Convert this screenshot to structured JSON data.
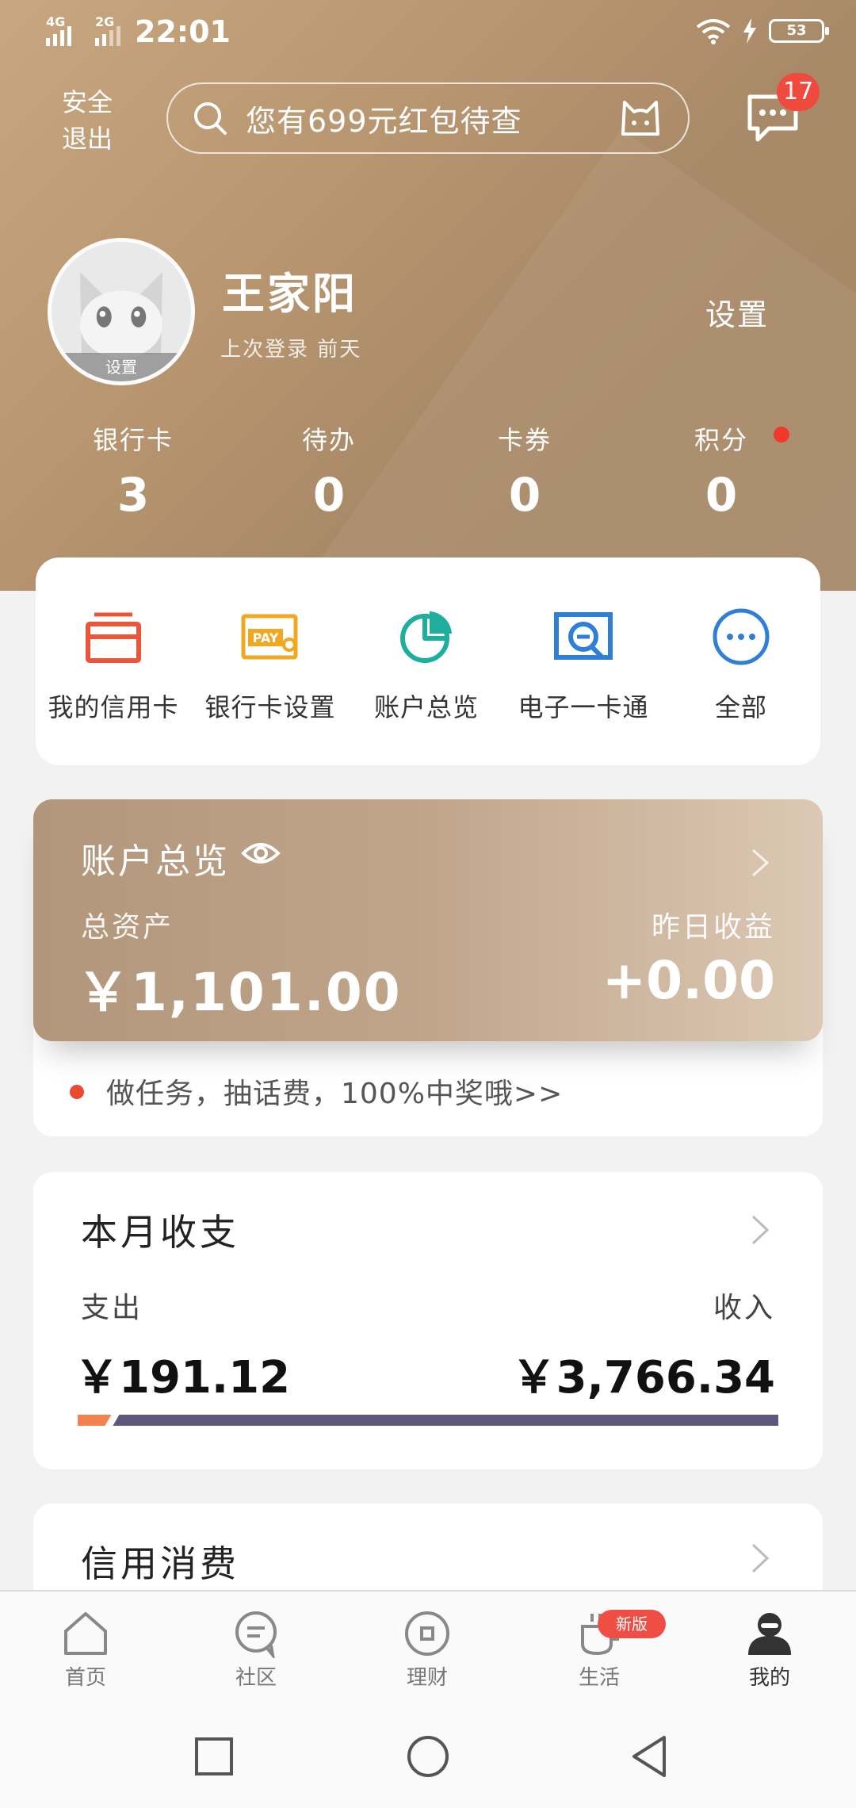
{
  "status": {
    "net1": "4G",
    "net2": "2G",
    "time": "22:01",
    "battery": "53"
  },
  "header": {
    "logout_label": "安全\n退出",
    "search_placeholder": "您有699元红包待查",
    "message_count": "17",
    "user_name": "王家阳",
    "last_login": "上次登录 前天",
    "settings_label": "设置",
    "avatar_label": "设置"
  },
  "stats": [
    {
      "label": "银行卡",
      "value": "3"
    },
    {
      "label": "待办",
      "value": "0"
    },
    {
      "label": "卡券",
      "value": "0"
    },
    {
      "label": "积分",
      "value": "0"
    }
  ],
  "quick_actions": [
    {
      "label": "我的信用卡",
      "icon": "credit-card-icon",
      "color": "#e8573a"
    },
    {
      "label": "银行卡设置",
      "icon": "pay-card-icon",
      "color": "#f0a821"
    },
    {
      "label": "账户总览",
      "icon": "pie-chart-icon",
      "color": "#1fae9c"
    },
    {
      "label": "电子一卡通",
      "icon": "ecard-icon",
      "color": "#2f7fd7"
    },
    {
      "label": "全部",
      "icon": "more-icon",
      "color": "#2f7fd7"
    }
  ],
  "overview": {
    "title": "账户总览",
    "assets_label": "总资产",
    "assets_value": "￥1,101.00",
    "income_label": "昨日收益",
    "income_value": "+0.00",
    "promo": "做任务，抽话费，100%中奖哦>>"
  },
  "monthly": {
    "title": "本月收支",
    "out_label": "支出",
    "out_value": "￥191.12",
    "in_label": "收入",
    "in_value": "￥3,766.34",
    "out_fraction": 0.048
  },
  "credit": {
    "title": "信用消费"
  },
  "tabs": [
    {
      "label": "首页",
      "icon": "home-icon"
    },
    {
      "label": "社区",
      "icon": "community-icon"
    },
    {
      "label": "理财",
      "icon": "finance-icon"
    },
    {
      "label": "生活",
      "icon": "life-icon"
    },
    {
      "label": "我的",
      "icon": "profile-icon"
    }
  ],
  "tab_badge": "新版",
  "colors": {
    "accent_red": "#f04a3e",
    "hero_brown": "#b89670"
  }
}
